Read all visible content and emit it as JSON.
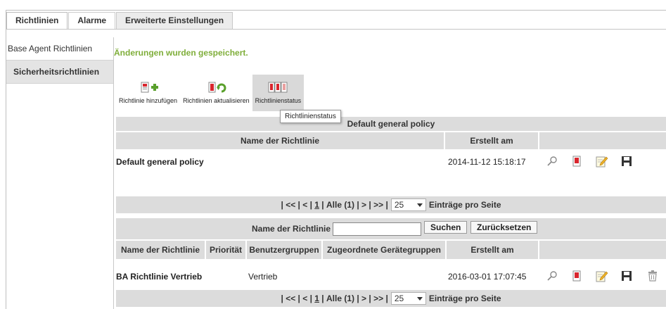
{
  "tabs": [
    {
      "label": "Richtlinien",
      "active": true
    },
    {
      "label": "Alarme",
      "active": false
    },
    {
      "label": "Erweiterte Einstellungen",
      "active": false
    }
  ],
  "sidebar": {
    "items": [
      {
        "label": "Base Agent Richtlinien",
        "active": false
      },
      {
        "label": "Sicherheitsrichtlinien",
        "active": true
      }
    ]
  },
  "message": "Änderungen wurden gespeichert.",
  "toolbar": {
    "add_label": "Richtlinie hinzufügen",
    "refresh_label": "Richtlinien aktualisieren",
    "status_label": "Richtlinienstatus",
    "tooltip": "Richtlinienstatus"
  },
  "default_table": {
    "title": "Default general policy",
    "headers": {
      "name": "Name der Richtlinie",
      "created": "Erstellt am"
    },
    "rows": [
      {
        "name": "Default general policy",
        "created": "2014-11-12 15:18:17"
      }
    ]
  },
  "pager": {
    "first": "<<",
    "prev": "<",
    "page": "1",
    "all": "Alle (1)",
    "next": ">",
    "last": ">>",
    "page_size": "25",
    "per_page_label": "Einträge pro Seite"
  },
  "filter": {
    "label": "Name der Richtlinie",
    "value": "",
    "search_label": "Suchen",
    "reset_label": "Zurücksetzen"
  },
  "policy_table": {
    "headers": {
      "name": "Name der Richtlinie",
      "priority": "Priorität",
      "user_groups": "Benutzergruppen",
      "device_groups": "Zugeordnete Gerätegruppen",
      "created": "Erstellt am"
    },
    "rows": [
      {
        "name": "BA Richtlinie Vertrieb",
        "priority": "",
        "user_groups": "Vertrieb",
        "device_groups": "",
        "created": "2016-03-01 17:07:45"
      }
    ]
  },
  "colors": {
    "success": "#7fae3a",
    "header_bg": "#dcdcdc",
    "policy_red": "#d9262e",
    "add_green": "#5aa02c"
  }
}
